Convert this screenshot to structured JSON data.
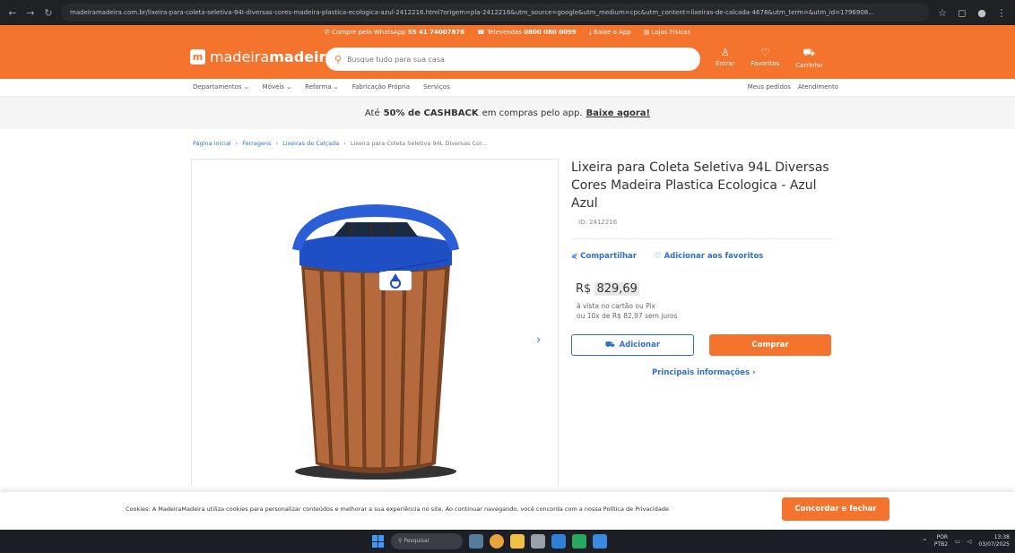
{
  "browser": {
    "url": "madeiramadeira.com.br/lixeira-para-coleta-seletiva-94l-diversas-cores-madeira-plastica-ecologica-azul-2412216.html?origem=pla-2412216&utm_source=google&utm_medium=cpc&utm_content=lixeiras-de-calcada-4678&utm_term=&utm_id=1796908..."
  },
  "topstrip": {
    "whatsapp_label": "Compre pelo WhatsApp",
    "whatsapp_number": "55 41 74007876",
    "televendas_label": "Televendas",
    "televendas_number": "0800 080 0099",
    "app_label": "Baixe o App",
    "stores_label": "Lojas Físicas"
  },
  "header": {
    "logo_light": "madeira",
    "logo_bold": "madeira",
    "search_placeholder": "Busque tudo para sua casa",
    "login_label": "Entrar",
    "favorites_label": "Favoritos",
    "cart_label": "Carrinho"
  },
  "catnav": {
    "items": [
      "Departamentos",
      "Móveis",
      "Reforma",
      "Fabricação Própria",
      "Serviços"
    ],
    "right": [
      "Meus pedidos",
      "Atendimento"
    ]
  },
  "cashback": {
    "prefix": "Até",
    "bold": "50% de CASHBACK",
    "middle": "em compras pelo app.",
    "link": "Baixe agora!"
  },
  "breadcrumb": {
    "items": [
      "Página inicial",
      "Ferragens",
      "Lixeiras de Calçada"
    ],
    "current": "Lixeira para Coleta Seletiva 94L Diversas Cor..."
  },
  "product": {
    "title": "Lixeira para Coleta Seletiva 94L Diversas Cores Madeira Plastica Ecologica - Azul Azul",
    "id_text": "ID: 2412216",
    "share_label": "Compartilhar",
    "favorite_label": "Adicionar aos favoritos",
    "price_currency": "R$",
    "price_value": "829,69",
    "price_note1": "à vista no cartão ou Pix",
    "price_note2": "ou 10x de R$ 82,97 sem juros",
    "add_label": "Adicionar",
    "buy_label": "Comprar",
    "info_link": "Principais informações"
  },
  "cookie": {
    "text": "Cookies: A MadeiraMadeira utiliza cookies para personalizar conteúdos e melhorar a sua experiência no site. Ao continuar navegando, você concorda com a nossa Política de Privacidade",
    "button": "Concordar e fechar"
  },
  "taskbar": {
    "search_placeholder": "Pesquisar",
    "lang1": "POR",
    "lang2": "PTB2",
    "time": "13:38",
    "date": "03/07/2025"
  },
  "colors": {
    "brand_orange": "#f4732d",
    "link_blue": "#2d6fd3",
    "bin_blue": "#1f4fc4",
    "wood": "#b46a3c"
  }
}
